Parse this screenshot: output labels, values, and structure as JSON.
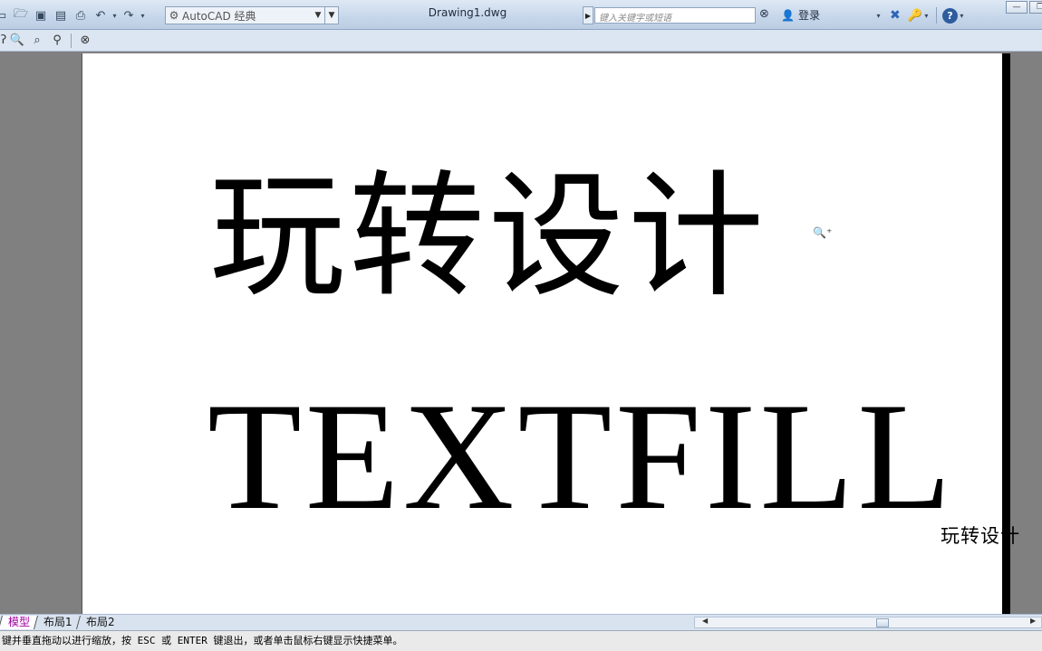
{
  "title_bar": {
    "workspace": "AutoCAD 经典",
    "document_title": "Drawing1.dwg",
    "search_placeholder": "键入关键字或短语",
    "login_label": "登录"
  },
  "drawing": {
    "line1": "玩转设计",
    "line2": "TEXTFILL",
    "outside_text": "玩转设计"
  },
  "tabs": [
    "模型",
    "布局1",
    "布局2"
  ],
  "active_tab": "模型",
  "status": {
    "message": "键并垂直拖动以进行缩放，按 ESC 或 ENTER 键退出，或者单击鼠标右键显示快捷菜单。"
  },
  "colors": {
    "paper": "#ffffff",
    "background": "#808080",
    "active_tab": "#a000a0"
  }
}
